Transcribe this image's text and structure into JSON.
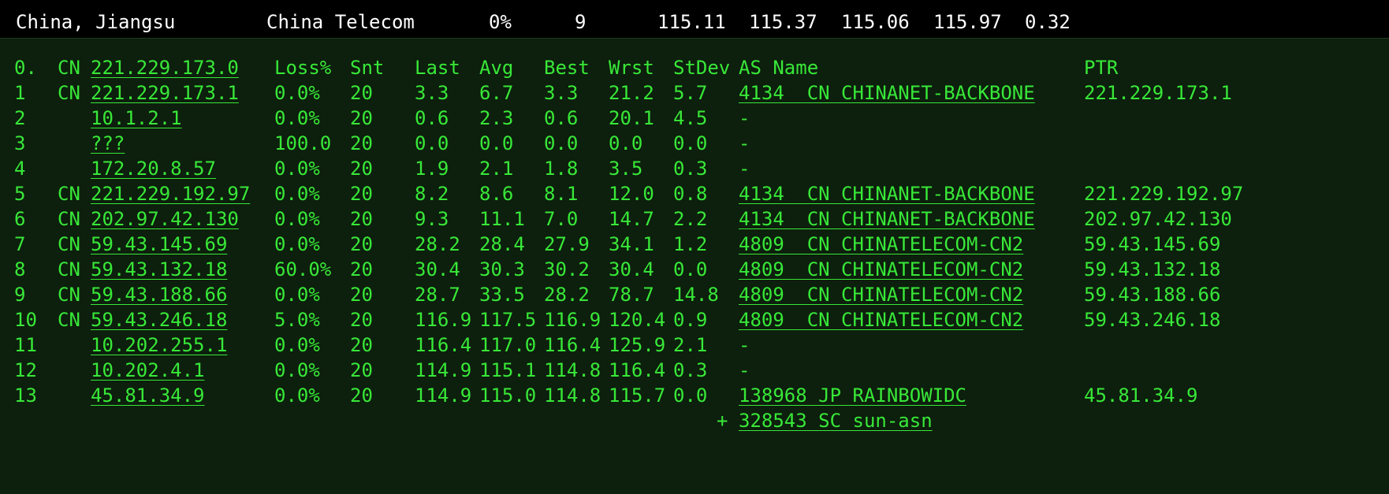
{
  "summary": {
    "location": "China, Jiangsu",
    "isp": "China Telecom",
    "loss": "0%",
    "sent": "9",
    "last": "115.11",
    "avg": "115.37",
    "best": "115.06",
    "worst": "115.97",
    "stdev": "0.32"
  },
  "header": {
    "hop": "0.",
    "cc": "CN",
    "host": "221.229.173.0",
    "loss": "Loss%",
    "snt": "Snt",
    "last": "Last",
    "avg": "Avg",
    "best": "Best",
    "wrst": "Wrst",
    "stdev": "StDev",
    "asname": "AS Name",
    "ptr": "PTR"
  },
  "hops": [
    {
      "hop": "1",
      "cc": "CN",
      "host": "221.229.173.1",
      "loss": "0.0%",
      "snt": "20",
      "last": "3.3",
      "avg": "6.7",
      "best": "3.3",
      "wrst": "21.2",
      "stdev": "5.7",
      "asname": "4134  CN CHINANET-BACKBONE",
      "ptr": "221.229.173.1"
    },
    {
      "hop": "2",
      "cc": "",
      "host": "10.1.2.1",
      "loss": "0.0%",
      "snt": "20",
      "last": "0.6",
      "avg": "2.3",
      "best": "0.6",
      "wrst": "20.1",
      "stdev": "4.5",
      "asname": "-",
      "ptr": ""
    },
    {
      "hop": "3",
      "cc": "",
      "host": "???",
      "loss": "100.0",
      "snt": "20",
      "last": "0.0",
      "avg": "0.0",
      "best": "0.0",
      "wrst": "0.0",
      "stdev": "0.0",
      "asname": "-",
      "ptr": ""
    },
    {
      "hop": "4",
      "cc": "",
      "host": "172.20.8.57",
      "loss": "0.0%",
      "snt": "20",
      "last": "1.9",
      "avg": "2.1",
      "best": "1.8",
      "wrst": "3.5",
      "stdev": "0.3",
      "asname": "-",
      "ptr": ""
    },
    {
      "hop": "5",
      "cc": "CN",
      "host": "221.229.192.97",
      "loss": "0.0%",
      "snt": "20",
      "last": "8.2",
      "avg": "8.6",
      "best": "8.1",
      "wrst": "12.0",
      "stdev": "0.8",
      "asname": "4134  CN CHINANET-BACKBONE",
      "ptr": "221.229.192.97"
    },
    {
      "hop": "6",
      "cc": "CN",
      "host": "202.97.42.130",
      "loss": "0.0%",
      "snt": "20",
      "last": "9.3",
      "avg": "11.1",
      "best": "7.0",
      "wrst": "14.7",
      "stdev": "2.2",
      "asname": "4134  CN CHINANET-BACKBONE",
      "ptr": "202.97.42.130"
    },
    {
      "hop": "7",
      "cc": "CN",
      "host": "59.43.145.69",
      "loss": "0.0%",
      "snt": "20",
      "last": "28.2",
      "avg": "28.4",
      "best": "27.9",
      "wrst": "34.1",
      "stdev": "1.2",
      "asname": "4809  CN CHINATELECOM-CN2",
      "ptr": "59.43.145.69"
    },
    {
      "hop": "8",
      "cc": "CN",
      "host": "59.43.132.18",
      "loss": "60.0%",
      "snt": "20",
      "last": "30.4",
      "avg": "30.3",
      "best": "30.2",
      "wrst": "30.4",
      "stdev": "0.0",
      "asname": "4809  CN CHINATELECOM-CN2",
      "ptr": "59.43.132.18"
    },
    {
      "hop": "9",
      "cc": "CN",
      "host": "59.43.188.66",
      "loss": "0.0%",
      "snt": "20",
      "last": "28.7",
      "avg": "33.5",
      "best": "28.2",
      "wrst": "78.7",
      "stdev": "14.8",
      "asname": "4809  CN CHINATELECOM-CN2",
      "ptr": "59.43.188.66"
    },
    {
      "hop": "10",
      "cc": "CN",
      "host": "59.43.246.18",
      "loss": "5.0%",
      "snt": "20",
      "last": "116.9",
      "avg": "117.5",
      "best": "116.9",
      "wrst": "120.4",
      "stdev": "0.9",
      "asname": "4809  CN CHINATELECOM-CN2",
      "ptr": "59.43.246.18"
    },
    {
      "hop": "11",
      "cc": "",
      "host": "10.202.255.1",
      "loss": "0.0%",
      "snt": "20",
      "last": "116.4",
      "avg": "117.0",
      "best": "116.4",
      "wrst": "125.9",
      "stdev": "2.1",
      "asname": "-",
      "ptr": ""
    },
    {
      "hop": "12",
      "cc": "",
      "host": "10.202.4.1",
      "loss": "0.0%",
      "snt": "20",
      "last": "114.9",
      "avg": "115.1",
      "best": "114.8",
      "wrst": "116.4",
      "stdev": "0.3",
      "asname": "-",
      "ptr": ""
    },
    {
      "hop": "13",
      "cc": "",
      "host": "45.81.34.9",
      "loss": "0.0%",
      "snt": "20",
      "last": "114.9",
      "avg": "115.0",
      "best": "114.8",
      "wrst": "115.7",
      "stdev": "0.0",
      "asname": "138968 JP RAINBOWIDC",
      "ptr": "45.81.34.9"
    }
  ],
  "extra_as": {
    "prefix": "+",
    "asname": "328543 SC sun-asn"
  }
}
